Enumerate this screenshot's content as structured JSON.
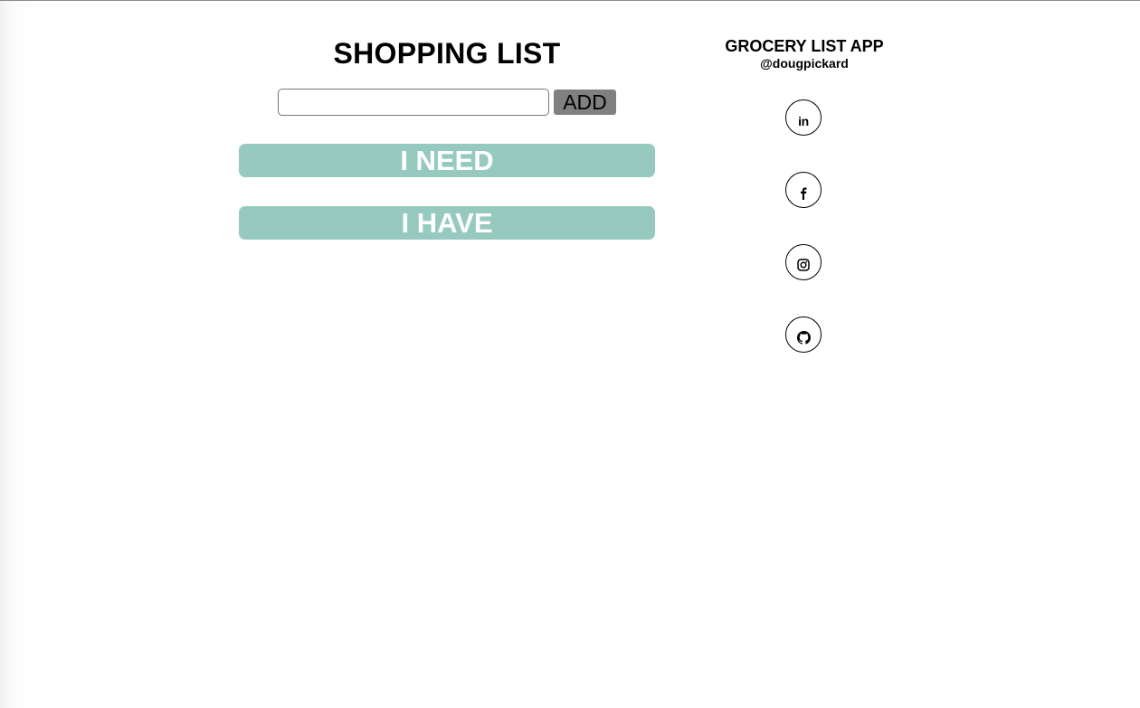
{
  "main": {
    "title": "SHOPPING LIST",
    "input": {
      "value": "",
      "placeholder": ""
    },
    "add_button_label": "ADD",
    "sections": [
      {
        "label": "I NEED"
      },
      {
        "label": "I HAVE"
      }
    ]
  },
  "sidebar": {
    "app_title": "GROCERY LIST APP",
    "handle": "@dougpickard",
    "social_links": [
      {
        "icon": "linkedin-icon",
        "glyph": "in"
      },
      {
        "icon": "facebook-icon"
      },
      {
        "icon": "instagram-icon"
      },
      {
        "icon": "github-icon"
      }
    ]
  },
  "colors": {
    "section_bar": "#97cabe",
    "add_button": "#808080"
  }
}
